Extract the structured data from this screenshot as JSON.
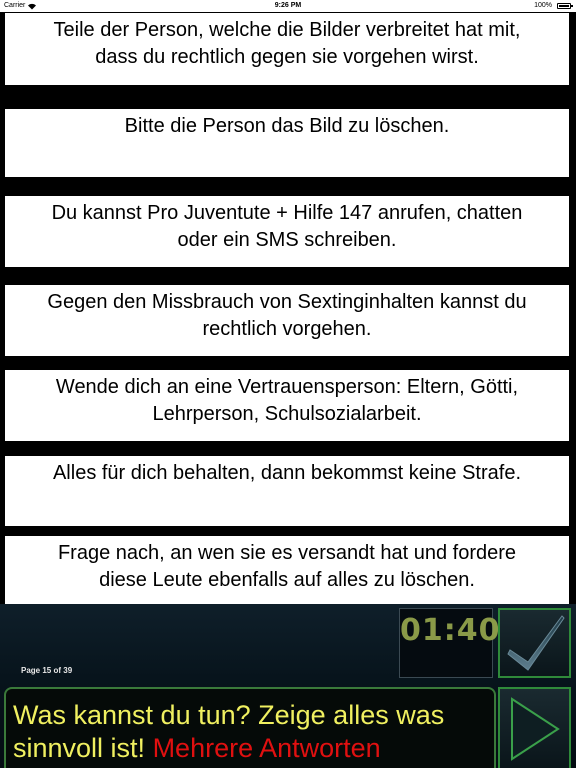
{
  "status_bar": {
    "carrier": "Carrier",
    "wifi_icon": "wifi-icon",
    "time": "9:26 PM",
    "battery_percent": "100%",
    "battery_icon": "battery-icon"
  },
  "answers": [
    {
      "line1": "Teile der Person, welche die Bilder verbreitet hat mit,",
      "line2": "dass du rechtlich gegen sie vorgehen wirst."
    },
    {
      "line1": "Bitte die Person das Bild zu löschen.",
      "line2": ""
    },
    {
      "line1": "Du kannst Pro Juventute + Hilfe 147 anrufen, chatten",
      "line2": "oder ein SMS schreiben."
    },
    {
      "line1": "Gegen den Missbrauch von Sextinginhalten kannst du",
      "line2": "rechtlich vorgehen."
    },
    {
      "line1": "Wende dich an eine Vertrauensperson: Eltern, Götti,",
      "line2": "Lehrperson, Schulsozialarbeit."
    },
    {
      "line1": "Alles für dich behalten, dann bekommst keine Strafe.",
      "line2": ""
    },
    {
      "line1": "Frage nach, an wen sie es versandt hat und fordere",
      "line2": "diese Leute ebenfalls auf alles zu löschen."
    }
  ],
  "footer": {
    "page_indicator": "Page 15 of 39",
    "timer": "01:40",
    "check_icon": "checkmark-icon",
    "next_icon": "play-arrow-icon",
    "question_part1": "Was kannst du tun? Zeige alles was",
    "question_part2": "sinnvoll ist!",
    "question_highlight": "Mehrere Antworten"
  },
  "colors": {
    "question_text": "#f0f060",
    "question_highlight": "#e01010",
    "timer_text": "#8a9a48",
    "button_border": "#2f8a3a"
  }
}
